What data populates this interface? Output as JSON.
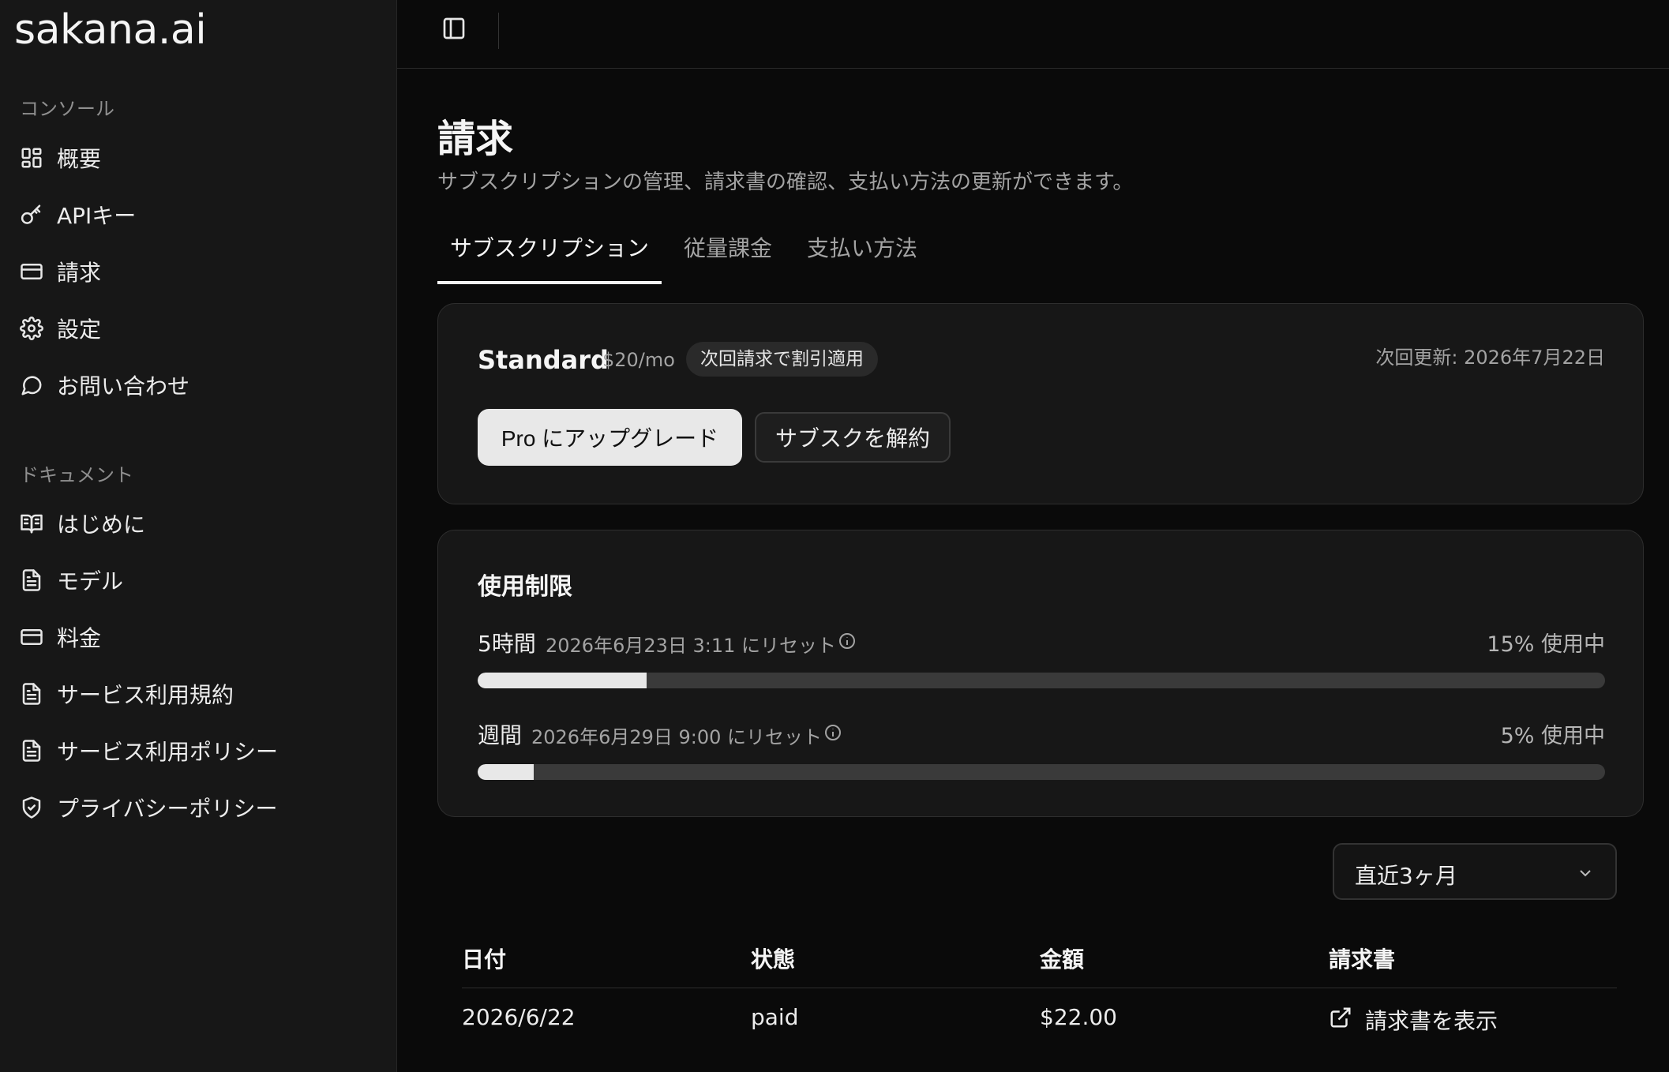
{
  "sidebar": {
    "logo": "sakana.ai",
    "console_label": "コンソール",
    "console_items": [
      {
        "label": "概要",
        "icon": "grid-icon"
      },
      {
        "label": "APIキー",
        "icon": "key-icon"
      },
      {
        "label": "請求",
        "icon": "credit-card-icon"
      },
      {
        "label": "設定",
        "icon": "gear-icon"
      },
      {
        "label": "お問い合わせ",
        "icon": "chat-bubble-icon"
      }
    ],
    "docs_label": "ドキュメント",
    "doc_items": [
      {
        "label": "はじめに",
        "icon": "book-open-icon"
      },
      {
        "label": "モデル",
        "icon": "document-icon"
      },
      {
        "label": "料金",
        "icon": "credit-card-icon"
      },
      {
        "label": "サービス利用規約",
        "icon": "document-icon"
      },
      {
        "label": "サービス利用ポリシー",
        "icon": "document-icon"
      },
      {
        "label": "プライバシーポリシー",
        "icon": "shield-check-icon"
      }
    ]
  },
  "page": {
    "title": "請求",
    "subtitle": "サブスクリプションの管理、請求書の確認、支払い方法の更新ができます。"
  },
  "tabs": [
    "サブスクリプション",
    "従量課金",
    "支払い方法"
  ],
  "plan": {
    "name": "Standard",
    "price": "$20/mo",
    "badge": "次回請求で割引適用",
    "renewal": "次回更新: 2026年7月22日",
    "upgrade_label": "Pro にアップグレード",
    "cancel_label": "サブスクを解約"
  },
  "usage": {
    "title": "使用制限",
    "rows": [
      {
        "label": "5時間",
        "reset": "2026年6月23日 3:11 にリセット",
        "percent_text": "15% 使用中",
        "percent": 15
      },
      {
        "label": "週間",
        "reset": "2026年6月29日 9:00 にリセット",
        "percent_text": "5% 使用中",
        "percent": 5
      }
    ]
  },
  "filter": {
    "value": "直近3ヶ月"
  },
  "invoices": {
    "headers": [
      "日付",
      "状態",
      "金額",
      "請求書"
    ],
    "rows": [
      {
        "date": "2026/6/22",
        "status": "paid",
        "amount": "$22.00",
        "link": "請求書を表示"
      }
    ]
  }
}
